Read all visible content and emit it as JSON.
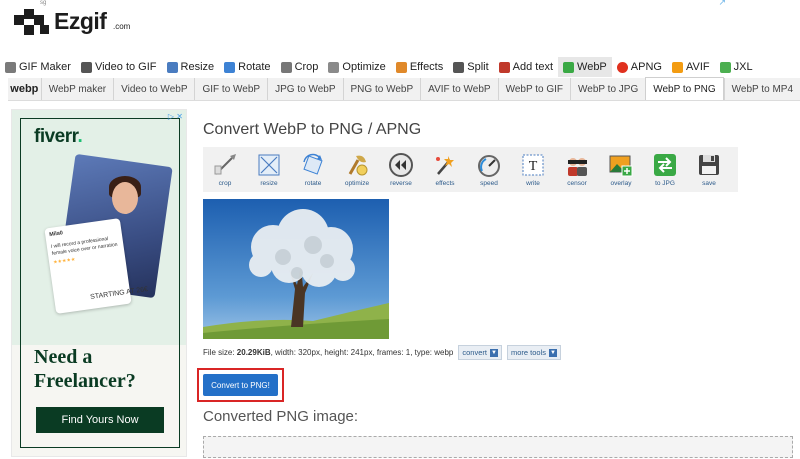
{
  "header": {
    "logo_text": "Ezgif",
    "logo_tld": ".com",
    "tiny_mark": "sg",
    "ad_mark": "↗"
  },
  "main_nav": [
    {
      "label": "GIF Maker",
      "icon": "gif-maker-icon",
      "color": "#7a7a7a"
    },
    {
      "label": "Video to GIF",
      "icon": "video-to-gif-icon",
      "color": "#555555"
    },
    {
      "label": "Resize",
      "icon": "resize-icon",
      "color": "#4a7cc0"
    },
    {
      "label": "Rotate",
      "icon": "rotate-icon",
      "color": "#3d82d4"
    },
    {
      "label": "Crop",
      "icon": "crop-icon",
      "color": "#777777"
    },
    {
      "label": "Optimize",
      "icon": "optimize-icon",
      "color": "#8a8a8a"
    },
    {
      "label": "Effects",
      "icon": "effects-icon",
      "color": "#e0892a"
    },
    {
      "label": "Split",
      "icon": "split-icon",
      "color": "#555555"
    },
    {
      "label": "Add text",
      "icon": "add-text-icon",
      "color": "#c0392b"
    },
    {
      "label": "WebP",
      "icon": "webp-icon",
      "color": "#3aa945",
      "active": true
    },
    {
      "label": "APNG",
      "icon": "apng-icon",
      "color": "#e0301e"
    },
    {
      "label": "AVIF",
      "icon": "avif-icon",
      "color": "#f39c12"
    },
    {
      "label": "JXL",
      "icon": "jxl-icon",
      "color": "#4caf50"
    }
  ],
  "sub_nav": {
    "logo": "webp",
    "items": [
      {
        "label": "WebP maker"
      },
      {
        "label": "Video to WebP"
      },
      {
        "label": "GIF to WebP"
      },
      {
        "label": "JPG to WebP"
      },
      {
        "label": "PNG to WebP"
      },
      {
        "label": "AVIF to WebP"
      },
      {
        "label": "WebP to GIF"
      },
      {
        "label": "WebP to JPG"
      },
      {
        "label": "WebP to PNG",
        "active": true
      },
      {
        "label": "WebP to MP4"
      }
    ]
  },
  "ad": {
    "brand": "fiverr",
    "brand_dot": ".",
    "card_name": "Mila0",
    "card_line": "I will record a professional female voice over or narration",
    "card_stars": "★★★★★",
    "card_price": "STARTING AT 26€",
    "headline_1": "Need a",
    "headline_2": "Freelancer?",
    "cta": "Find Yours Now",
    "choices": "▷ ✕"
  },
  "main": {
    "title": "Convert WebP to PNG / APNG",
    "tools": [
      {
        "label": "crop",
        "icon": "crop-tool-icon"
      },
      {
        "label": "resize",
        "icon": "resize-tool-icon"
      },
      {
        "label": "rotate",
        "icon": "rotate-tool-icon"
      },
      {
        "label": "optimize",
        "icon": "optimize-tool-icon"
      },
      {
        "label": "reverse",
        "icon": "reverse-tool-icon"
      },
      {
        "label": "effects",
        "icon": "effects-tool-icon"
      },
      {
        "label": "speed",
        "icon": "speed-tool-icon"
      },
      {
        "label": "write",
        "icon": "write-tool-icon"
      },
      {
        "label": "censor",
        "icon": "censor-tool-icon"
      },
      {
        "label": "overlay",
        "icon": "overlay-tool-icon"
      },
      {
        "label": "to JPG",
        "icon": "to-jpg-tool-icon"
      },
      {
        "label": "save",
        "icon": "save-tool-icon"
      }
    ],
    "file_info_prefix": "File size: ",
    "file_size": "20.29KiB",
    "file_info_rest": ", width: 320px, height: 241px, frames: 1, type: webp",
    "convert_link": "convert",
    "more_tools": "more tools",
    "convert_button": "Convert to PNG!",
    "converted_title": "Converted PNG image:"
  },
  "colors": {
    "accent_blue": "#2370c8",
    "highlight_red": "#d92525",
    "fiverr_green": "#0a3b23",
    "fiverr_dot": "#1dbf73"
  }
}
